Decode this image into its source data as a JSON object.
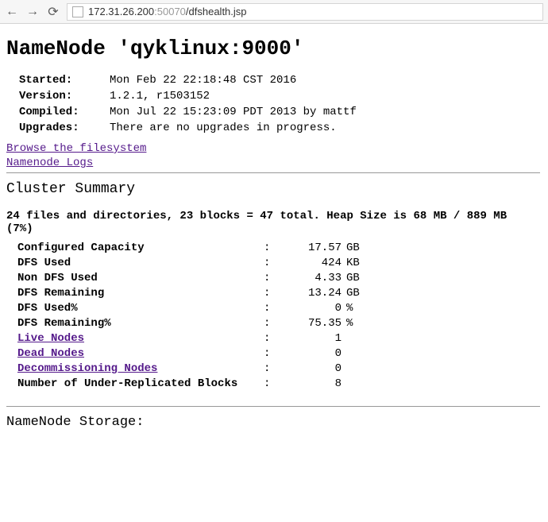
{
  "browser": {
    "url": {
      "host": "172.31.26.200",
      "port": ":50070",
      "path": "/dfshealth.jsp"
    }
  },
  "page": {
    "title": "NameNode 'qyklinux:9000'",
    "meta": {
      "started": {
        "key": "Started:",
        "val": "Mon Feb 22 22:18:48 CST 2016"
      },
      "version": {
        "key": "Version:",
        "val": "1.2.1, r1503152"
      },
      "compiled": {
        "key": "Compiled:",
        "val": "Mon Jul 22 15:23:09 PDT 2013 by mattf"
      },
      "upgrades": {
        "key": "Upgrades:",
        "val": "There are no upgrades in progress."
      }
    },
    "links": {
      "browse": "Browse the filesystem",
      "logs": "Namenode Logs"
    },
    "cluster_summary": {
      "heading": "Cluster Summary",
      "line": "24 files and directories, 23 blocks = 47 total. Heap Size is 68 MB / 889 MB (7%)",
      "rows": {
        "configured_capacity": {
          "label": "Configured Capacity",
          "value": "17.57",
          "unit": "GB"
        },
        "dfs_used": {
          "label": "DFS Used",
          "value": "424",
          "unit": "KB"
        },
        "non_dfs_used": {
          "label": "Non DFS Used",
          "value": "4.33",
          "unit": "GB"
        },
        "dfs_remaining": {
          "label": "DFS Remaining",
          "value": "13.24",
          "unit": "GB"
        },
        "dfs_used_pct": {
          "label": "DFS Used%",
          "value": "0",
          "unit": "%"
        },
        "dfs_remaining_pct": {
          "label": "DFS Remaining%",
          "value": "75.35",
          "unit": "%"
        },
        "live_nodes": {
          "label": "Live Nodes",
          "value": "1",
          "unit": ""
        },
        "dead_nodes": {
          "label": "Dead Nodes",
          "value": "0",
          "unit": ""
        },
        "decommissioning": {
          "label": "Decommissioning Nodes",
          "value": "0",
          "unit": ""
        },
        "under_replicated": {
          "label": "Number of Under-Replicated Blocks",
          "value": "8",
          "unit": ""
        }
      }
    },
    "storage_heading": "NameNode Storage:"
  }
}
